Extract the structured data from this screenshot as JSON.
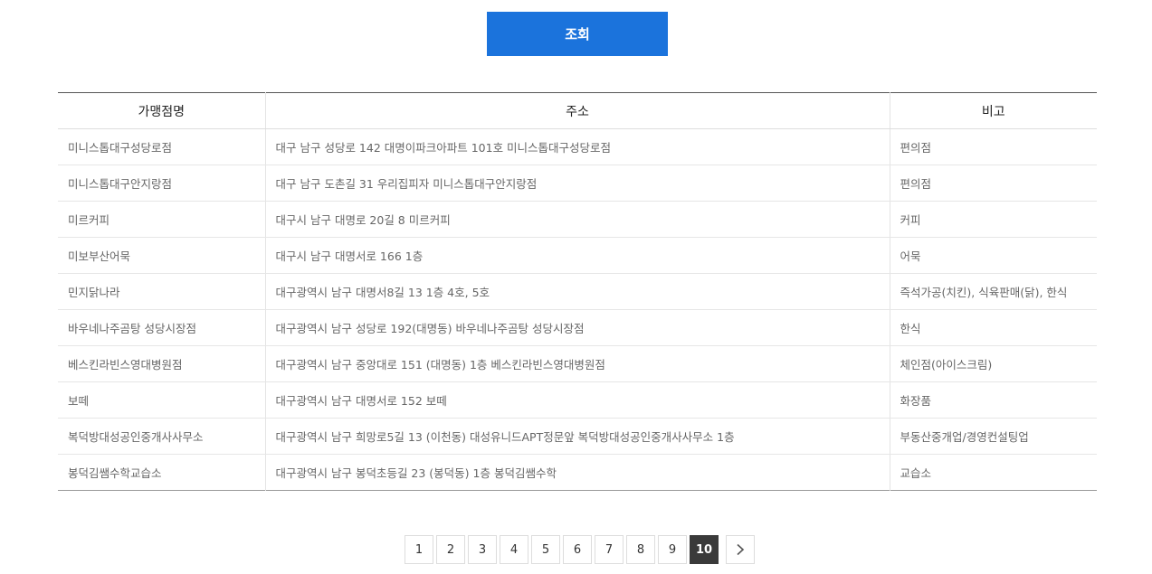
{
  "search": {
    "button_label": "조회"
  },
  "table": {
    "headers": [
      "가맹점명",
      "주소",
      "비고"
    ],
    "rows": [
      {
        "name": "미니스톱대구성당로점",
        "address": "대구 남구 성당로 142 대명이파크아파트 101호 미니스톱대구성당로점",
        "note": "편의점"
      },
      {
        "name": "미니스톱대구안지랑점",
        "address": "대구 남구 도촌길 31 우리집피자 미니스톱대구안지랑점",
        "note": "편의점"
      },
      {
        "name": "미르커피",
        "address": "대구시 남구 대명로 20길 8 미르커피",
        "note": "커피"
      },
      {
        "name": "미보부산어묵",
        "address": "대구시 남구 대명서로 166 1층",
        "note": "어묵"
      },
      {
        "name": "민지닭나라",
        "address": "대구광역시 남구 대명서8길 13 1층 4호, 5호",
        "note": "즉석가공(치킨), 식육판매(닭), 한식"
      },
      {
        "name": "바우네나주곰탕 성당시장점",
        "address": "대구광역시 남구 성당로 192(대명동) 바우네나주곰탕 성당시장점",
        "note": "한식"
      },
      {
        "name": "베스킨라빈스영대병원점",
        "address": "대구광역시 남구 중앙대로 151 (대명동) 1층 베스킨라빈스영대병원점",
        "note": "체인점(아이스크림)"
      },
      {
        "name": "보떼",
        "address": "대구광역시 남구 대명서로 152 보떼",
        "note": "화장품"
      },
      {
        "name": "복덕방대성공인중개사사무소",
        "address": "대구광역시 남구 희망로5길 13 (이천동) 대성유니드APT정문앞 복덕방대성공인중개사사무소 1층",
        "note": "부동산중개업/경영컨설팅업"
      },
      {
        "name": "봉덕김쌤수학교습소",
        "address": "대구광역시 남구 봉덕초등길 23 (봉덕동) 1층 봉덕김쌤수학",
        "note": "교습소"
      }
    ]
  },
  "pagination": {
    "pages": [
      "1",
      "2",
      "3",
      "4",
      "5",
      "6",
      "7",
      "8",
      "9",
      "10"
    ],
    "current": "10",
    "next_icon": "chevron-right-icon"
  }
}
